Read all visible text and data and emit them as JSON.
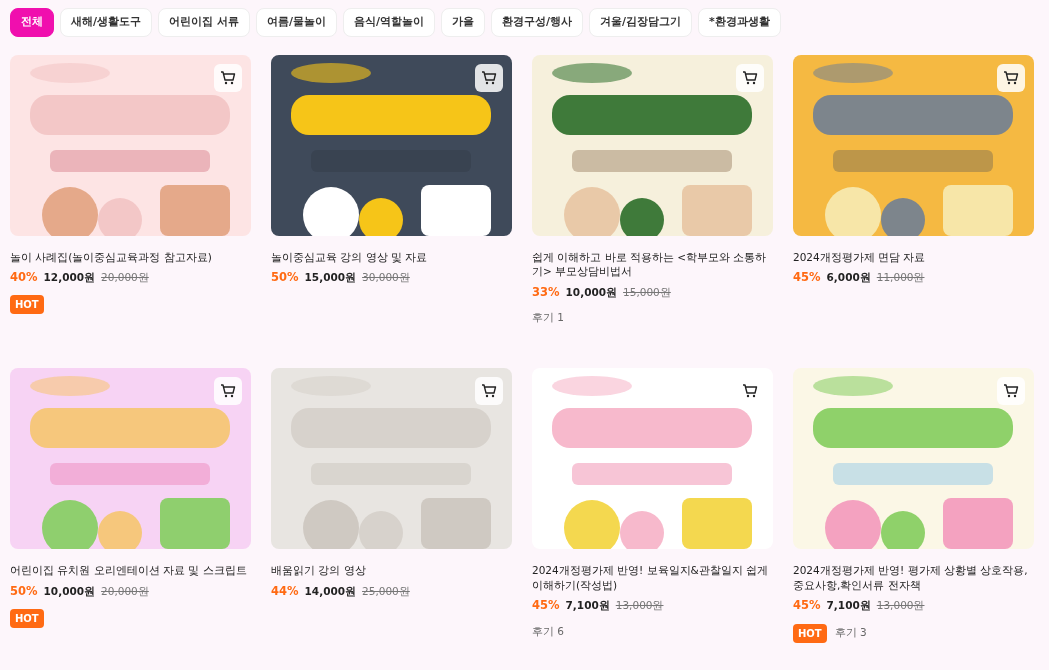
{
  "categories": [
    {
      "label": "전체",
      "selected": true
    },
    {
      "label": "새해/생활도구",
      "selected": false
    },
    {
      "label": "어린이집 서류",
      "selected": false
    },
    {
      "label": "여름/물놀이",
      "selected": false
    },
    {
      "label": "음식/역할놀이",
      "selected": false
    },
    {
      "label": "가을",
      "selected": false
    },
    {
      "label": "환경구성/행사",
      "selected": false
    },
    {
      "label": "겨울/김장담그기",
      "selected": false
    },
    {
      "label": "*환경과생활",
      "selected": false
    }
  ],
  "products": [
    {
      "title": "놀이 사례집(놀이중심교육과정 참고자료)",
      "discount": "40%",
      "price": "12,000원",
      "original_price": "20,000원",
      "badges": [
        "HOT"
      ]
    },
    {
      "title": "놀이중심교육 강의 영상 및 자료",
      "discount": "50%",
      "price": "15,000원",
      "original_price": "30,000원"
    },
    {
      "title": "쉽게 이해하고 바로 적용하는 <학부모와 소통하기> 부모상담비법서",
      "discount": "33%",
      "price": "10,000원",
      "original_price": "15,000원",
      "reviews": "후기 1"
    },
    {
      "title": "2024개정평가제 면담 자료",
      "discount": "45%",
      "price": "6,000원",
      "original_price": "11,000원"
    },
    {
      "title": "어린이집 유치원 오리엔테이션 자료 및 스크립트",
      "discount": "50%",
      "price": "10,000원",
      "original_price": "20,000원",
      "badges": [
        "HOT"
      ]
    },
    {
      "title": "배움읽기 강의 영상",
      "discount": "44%",
      "price": "14,000원",
      "original_price": "25,000원"
    },
    {
      "title": "2024개정평가제 반영! 보육일지&관찰일지 쉽게 이해하기(작성법)",
      "discount": "45%",
      "price": "7,100원",
      "original_price": "13,000원",
      "reviews": "후기 6"
    },
    {
      "title": "2024개정평가제 반영! 평가제 상황별 상호작용,중요사항,확인서류 전자책",
      "discount": "45%",
      "price": "7,100원",
      "original_price": "13,000원",
      "badges": [
        "HOT"
      ],
      "reviews": "후기 3"
    }
  ]
}
